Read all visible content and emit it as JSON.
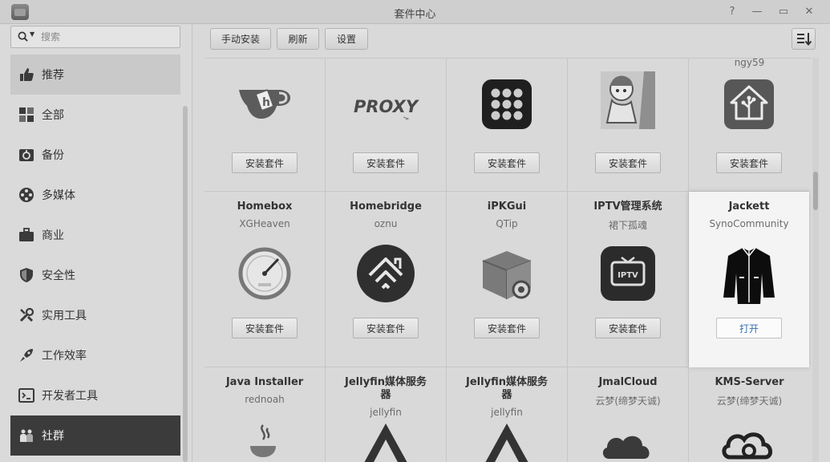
{
  "window": {
    "title": "套件中心",
    "help": "?",
    "minimize": "—",
    "maximize": "▭",
    "close": "✕"
  },
  "search": {
    "placeholder": "搜索"
  },
  "sidebar": {
    "items": [
      {
        "label": "推荐",
        "icon": "thumbs-up-icon"
      },
      {
        "label": "全部",
        "icon": "grid-icon"
      },
      {
        "label": "备份",
        "icon": "backup-icon"
      },
      {
        "label": "多媒体",
        "icon": "film-reel-icon"
      },
      {
        "label": "商业",
        "icon": "briefcase-icon"
      },
      {
        "label": "安全性",
        "icon": "shield-icon"
      },
      {
        "label": "实用工具",
        "icon": "tools-icon"
      },
      {
        "label": "工作效率",
        "icon": "rocket-icon"
      },
      {
        "label": "开发者工具",
        "icon": "terminal-icon"
      },
      {
        "label": "社群",
        "icon": "community-icon"
      }
    ]
  },
  "toolbar": {
    "manual_install": "手动安装",
    "refresh": "刷新",
    "settings": "设置"
  },
  "packages": {
    "row1": [
      {
        "author": "",
        "icon": "gitea-cup-icon",
        "button": "安装套件"
      },
      {
        "author": "",
        "icon": "proxy-logo-icon",
        "logo_text": "PROXY",
        "button": "安装套件"
      },
      {
        "author": "",
        "icon": "dots-grid-icon",
        "button": "安装套件"
      },
      {
        "author": "",
        "icon": "anime-character-icon",
        "button": "安装套件"
      },
      {
        "author": "ngy59",
        "icon": "home-tree-icon",
        "button": "安装套件"
      }
    ],
    "row2": [
      {
        "name": "Homebox",
        "author": "XGHeaven",
        "icon": "gauge-icon",
        "button": "安装套件"
      },
      {
        "name": "Homebridge",
        "author": "oznu",
        "icon": "homebridge-icon",
        "button": "安装套件"
      },
      {
        "name": "iPKGui",
        "author": "QTip",
        "icon": "package-box-icon",
        "button": "安装套件"
      },
      {
        "name": "IPTV管理系统",
        "author": "裙下孤魂",
        "icon": "iptv-tv-icon",
        "iptv_text": "IPTV",
        "button": "安装套件"
      },
      {
        "name": "Jackett",
        "author": "SynoCommunity",
        "icon": "jacket-icon",
        "button": "打开"
      }
    ],
    "row3": [
      {
        "name": "Java Installer",
        "author": "rednoah",
        "icon": "java-cup-icon"
      },
      {
        "name": "Jellyfin媒体服务器",
        "author": "jellyfin",
        "icon": "jellyfin-icon"
      },
      {
        "name": "Jellyfin媒体服务器",
        "author": "jellyfin",
        "icon": "jellyfin-icon"
      },
      {
        "name": "JmalCloud",
        "author": "云梦(缔梦天诚)",
        "icon": "cloud-icon"
      },
      {
        "name": "KMS-Server",
        "author": "云梦(缔梦天诚)",
        "icon": "kms-server-icon"
      }
    ]
  }
}
